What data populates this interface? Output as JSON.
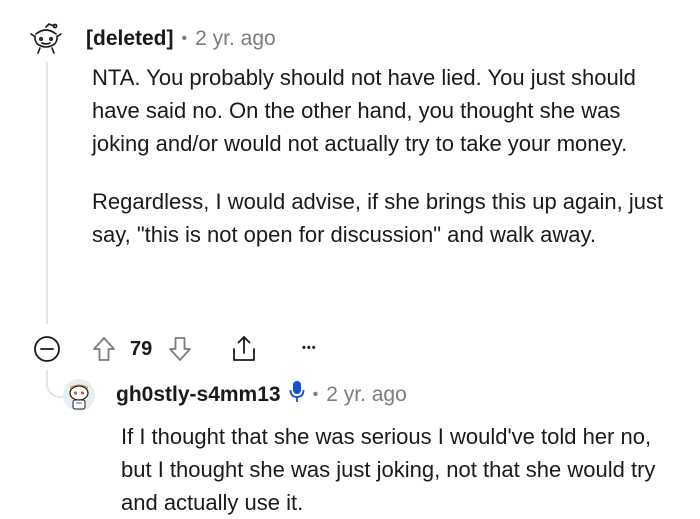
{
  "comment": {
    "author": "[deleted]",
    "time": "2 yr. ago",
    "paragraphs": [
      "NTA. You probably should not have lied. You just should have said no. On the other hand, you thought she was joking and/or would not actually try to take your money.",
      "Regardless, I would advise, if she brings this up again, just say, \"this is not open for discussion\" and walk away."
    ],
    "votes": "79",
    "more_label": "•••"
  },
  "reply": {
    "author": "gh0stly-s4mm13",
    "time": "2 yr. ago",
    "text": "If I thought that she was serious I would've told her no, but I thought she was just joking, not that she would try and actually use it."
  },
  "icons": {
    "deleted_avatar": "snoo-outline-icon",
    "collapse": "minus-circle-icon",
    "upvote": "arrow-up-icon",
    "downvote": "arrow-down-icon",
    "share": "share-icon",
    "more": "more-dots-icon",
    "reply_avatar": "snoo-avatar-icon",
    "mic": "microphone-icon"
  },
  "colors": {
    "accent_blue": "#0f4fd9",
    "meta_gray": "#7c7c7c"
  }
}
